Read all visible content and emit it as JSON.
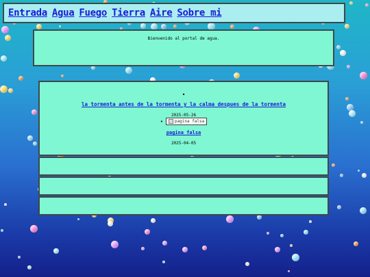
{
  "nav": {
    "items": [
      "Entrada",
      "Agua",
      "Fuego",
      "Tierra",
      "Aire",
      "Sobre mi"
    ]
  },
  "welcome": {
    "text": "Bienvenido al portal de agua."
  },
  "post": {
    "bullet": "•",
    "title": "la tormenta antes de la tormenta y la calma despues de la tormenta",
    "date": "2025-05-26",
    "image_alt": "pagina falsa",
    "link": "pagina falsa",
    "date2": "2025-04-05"
  },
  "colors": {
    "panel": "#7ff7d2",
    "nav": "#aaeef0",
    "link": "#1a1ad8"
  }
}
